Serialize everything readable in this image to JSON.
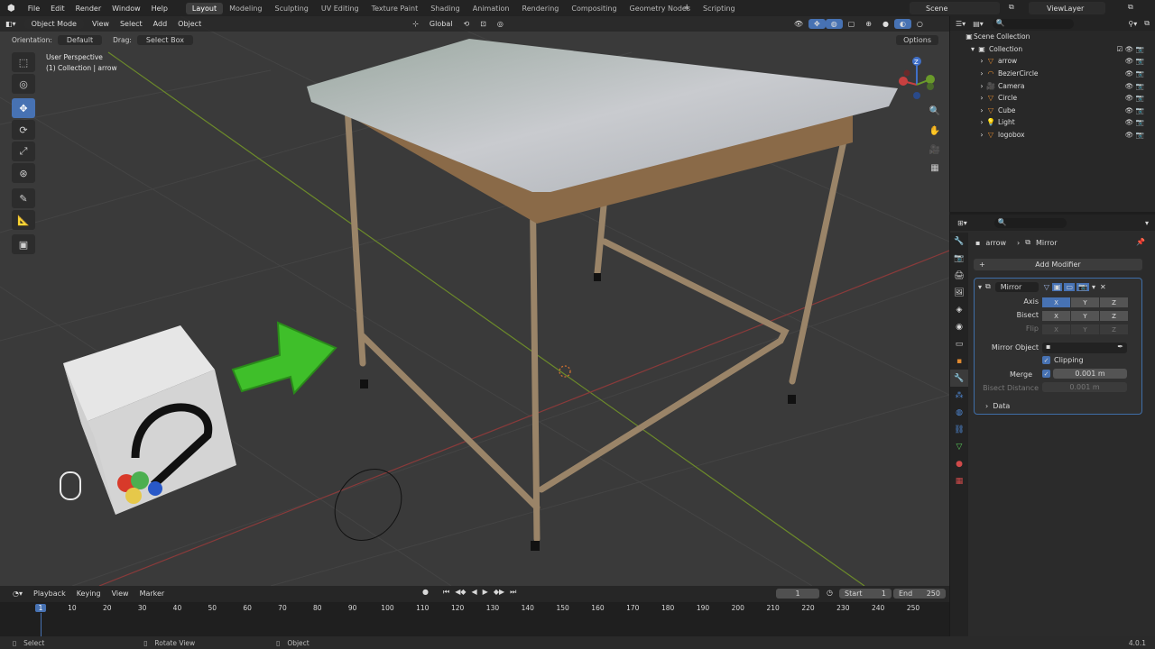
{
  "menu": {
    "file": "File",
    "edit": "Edit",
    "render": "Render",
    "window": "Window",
    "help": "Help"
  },
  "workspaces": [
    "Layout",
    "Modeling",
    "Sculpting",
    "UV Editing",
    "Texture Paint",
    "Shading",
    "Animation",
    "Rendering",
    "Compositing",
    "Geometry Nodes",
    "Scripting"
  ],
  "scene": "Scene",
  "view_layer": "ViewLayer",
  "viewport": {
    "mode": "Object Mode",
    "menus": {
      "view": "View",
      "select": "Select",
      "add": "Add",
      "object": "Object"
    },
    "transform": "Global",
    "orientation_label": "Orientation:",
    "orientation_value": "Default",
    "drag_label": "Drag:",
    "drag_value": "Select Box",
    "options": "Options",
    "overlay_line1": "User Perspective",
    "overlay_line2": "(1) Collection | arrow",
    "gizmo_x": "X",
    "gizmo_y": "Y",
    "gizmo_z": "Z"
  },
  "outliner": {
    "scene_collection": "Scene Collection",
    "collection": "Collection",
    "items": [
      {
        "name": "arrow",
        "icon": "mesh-icon"
      },
      {
        "name": "BezierCircle",
        "icon": "curve-icon"
      },
      {
        "name": "Camera",
        "icon": "camera-icon"
      },
      {
        "name": "Circle",
        "icon": "mesh-icon"
      },
      {
        "name": "Cube",
        "icon": "mesh-icon"
      },
      {
        "name": "Light",
        "icon": "light-icon"
      },
      {
        "name": "logobox",
        "icon": "mesh-icon"
      }
    ]
  },
  "properties": {
    "object": "arrow",
    "modifier_crumb": "Mirror",
    "add_modifier": "Add Modifier",
    "modifier_name": "Mirror",
    "axis_label": "Axis",
    "bisect_label": "Bisect",
    "flip_label": "Flip",
    "x": "X",
    "y": "Y",
    "z": "Z",
    "mirror_object_label": "Mirror Object",
    "clipping": "Clipping",
    "merge_label": "Merge",
    "merge_value": "0.001 m",
    "bisect_distance_label": "Bisect Distance",
    "bisect_distance_value": "0.001 m",
    "data": "Data"
  },
  "timeline": {
    "playback": "Playback",
    "keying": "Keying",
    "view": "View",
    "marker": "Marker",
    "current_frame": "1",
    "start_label": "Start",
    "start_value": "1",
    "end_label": "End",
    "end_value": "250",
    "ticks": [
      "1",
      "10",
      "20",
      "30",
      "40",
      "50",
      "60",
      "70",
      "80",
      "90",
      "100",
      "110",
      "120",
      "130",
      "140",
      "150",
      "160",
      "170",
      "180",
      "190",
      "200",
      "210",
      "220",
      "230",
      "240",
      "250"
    ]
  },
  "status": {
    "select": "Select",
    "rotate": "Rotate View",
    "object": "Object",
    "version": "4.0.1"
  },
  "colors": {
    "accent": "#4772b3",
    "green_arrow": "#3fbf2a",
    "table_top": "#c9cbcf",
    "table_frame": "#9a8468"
  }
}
